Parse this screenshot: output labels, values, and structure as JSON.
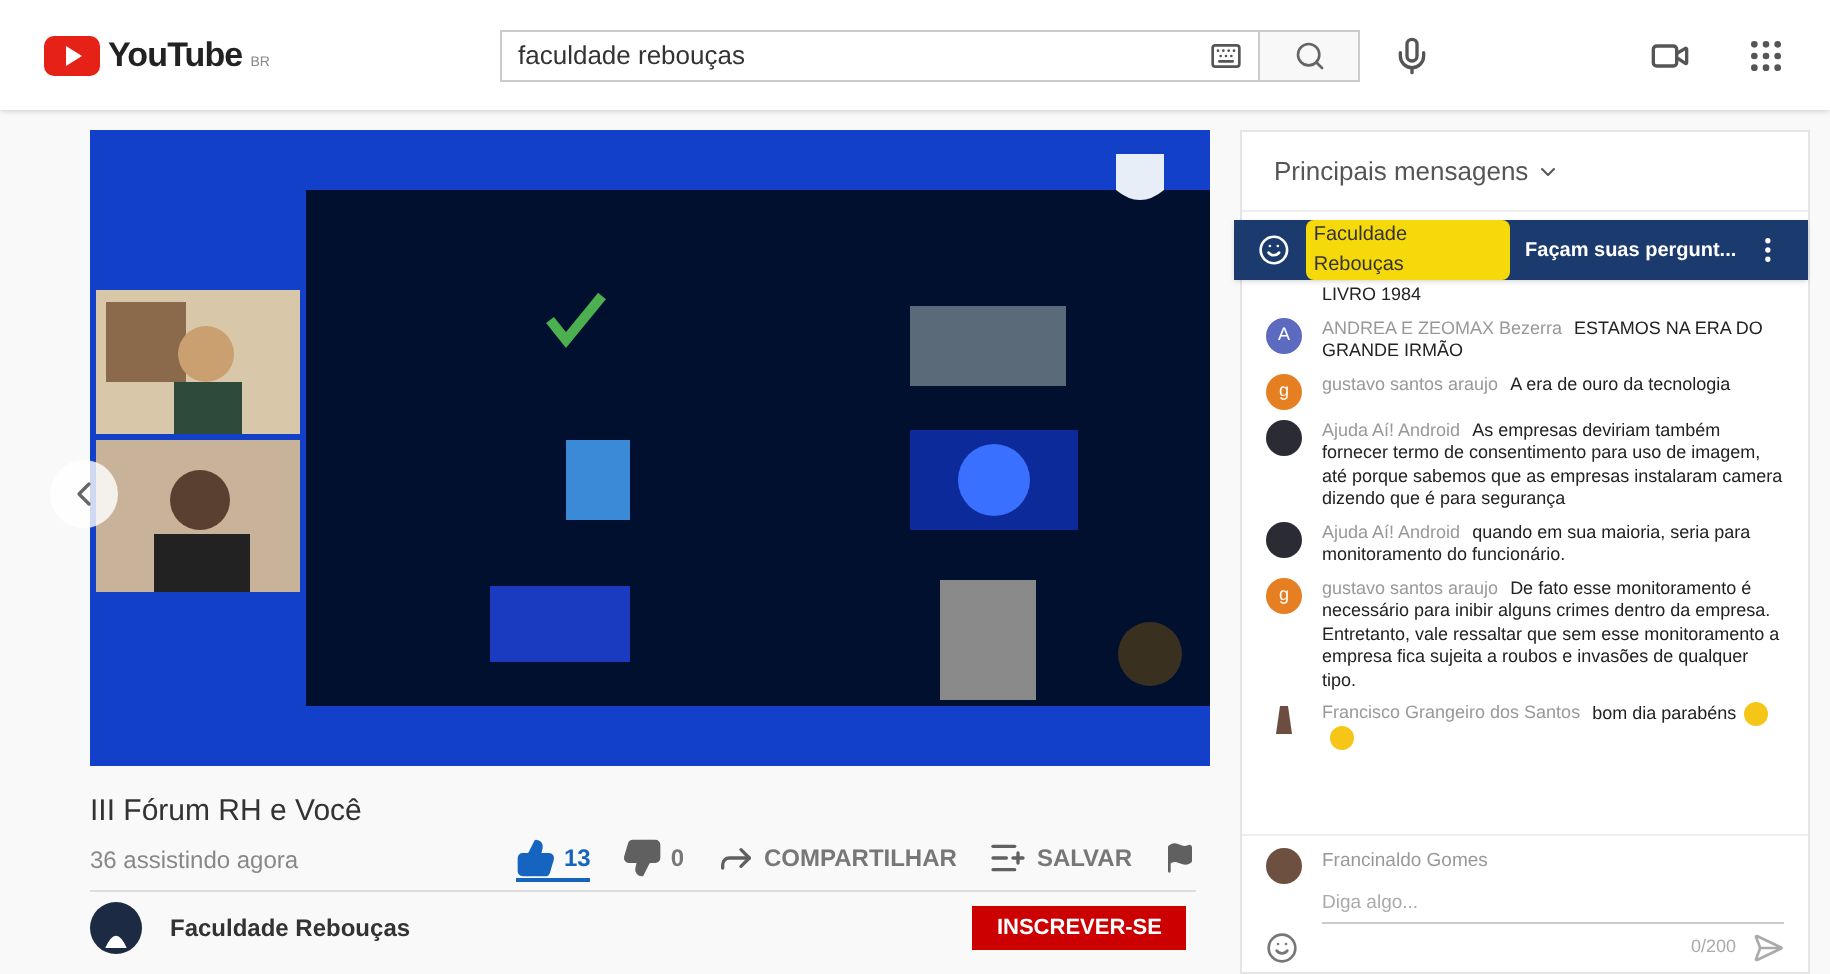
{
  "header": {
    "logo": "YouTube",
    "region": "BR",
    "search": {
      "value": "faculdade rebouças"
    }
  },
  "title": "III Fórum RH e Você",
  "viewers": "36 assistindo agora",
  "actions": [
    {
      "kind": "like",
      "label": "13",
      "selected": true
    },
    {
      "kind": "dislike",
      "label": "0",
      "selected": false
    },
    {
      "kind": "share",
      "label": "COMPARTILHAR",
      "selected": false
    },
    {
      "kind": "save",
      "label": "SALVAR",
      "selected": false
    },
    {
      "kind": "flag",
      "selected": false
    }
  ],
  "channel": {
    "name": "Faculdade Rebouças",
    "subscribe": "INSCREVER-SE"
  },
  "chat": {
    "title": "Principais mensagens",
    "pinned": {
      "author": "Faculdade Rebouças",
      "text": "Façam suas pergunt..."
    },
    "messages": [
      {
        "kind": "cut",
        "text": "LIVRO 1984"
      },
      {
        "kind": "letter",
        "letter": "A",
        "color": "#5c6bc0",
        "author": "ANDREA E ZEOMAX Bezerra",
        "text": "ESTAMOS NA ERA DO GRANDE IRMÃO"
      },
      {
        "kind": "letter",
        "letter": "g",
        "color": "#e67e22",
        "author": "gustavo santos araujo",
        "text": "A era de ouro da tecnologia"
      },
      {
        "color": "#2b2b33",
        "author": "Ajuda Aí! Android",
        "text": "As empresas deviriam também fornecer termo de consentimento para uso de imagem, até porque sabemos que as empresas instalaram camera dizendo que é para segurança"
      },
      {
        "color": "#2b2b33",
        "author": "Ajuda Aí! Android",
        "text": "quando em sua maioria, seria para monitoramento do funcionário."
      },
      {
        "kind": "letter",
        "letter": "g",
        "color": "#e67e22",
        "author": "gustavo santos araujo",
        "text": "De fato esse monitoramento é necessário para inibir alguns crimes dentro da empresa. Entretanto, vale ressaltar que sem esse monitoramento a empresa fica sujeita a roubos e invasões de qualquer tipo."
      },
      {
        "kind": "figure",
        "color": "#6d4c41",
        "author": "Francisco Grangeiro dos Santos",
        "text": "bom dia parabéns",
        "reactions": [
          {
            "kind": "clap"
          },
          {
            "kind": "clap"
          }
        ]
      }
    ],
    "input": {
      "user": "Francinaldo Gomes",
      "placeholder": "Diga algo...",
      "counter": "0/200"
    }
  }
}
